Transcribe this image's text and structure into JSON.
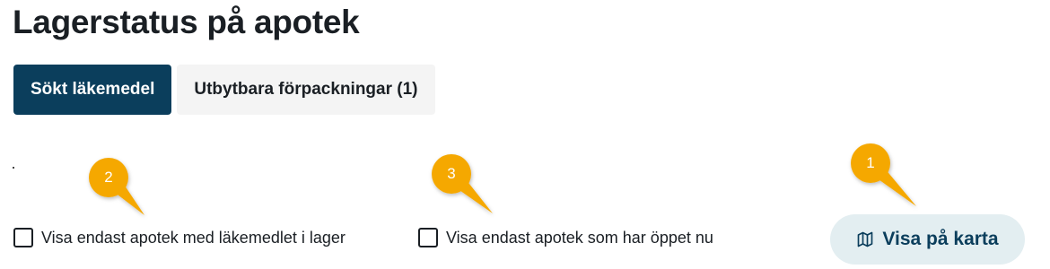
{
  "page": {
    "title": "Lagerstatus på apotek"
  },
  "tabs": [
    {
      "label": "Sökt läkemedel",
      "active": true
    },
    {
      "label": "Utbytbara förpackningar (1)",
      "active": false
    }
  ],
  "filters": [
    {
      "label": "Visa endast apotek med läkemedlet i lager",
      "checked": false
    },
    {
      "label": "Visa endast apotek som har öppet nu",
      "checked": false
    }
  ],
  "map_button": {
    "label": "Visa på karta",
    "icon": "map-icon"
  },
  "annotations": [
    {
      "number": "1",
      "target": "map-button"
    },
    {
      "number": "2",
      "target": "filter-in-stock"
    },
    {
      "number": "3",
      "target": "filter-open-now"
    }
  ],
  "colors": {
    "primary": "#0b3e5c",
    "tab_inactive_bg": "#f4f4f4",
    "map_button_bg": "#e3eef1",
    "marker": "#f5a800"
  }
}
